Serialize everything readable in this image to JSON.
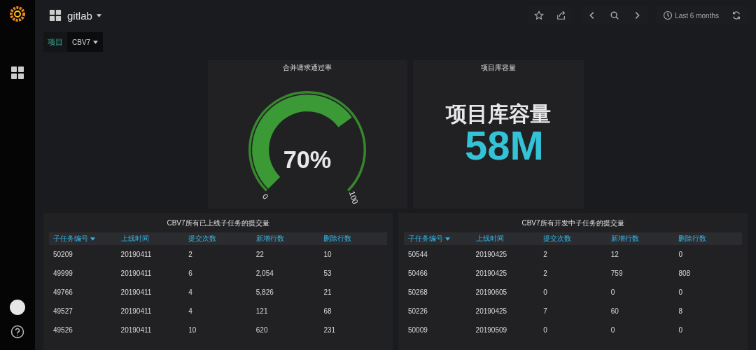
{
  "dashboard": {
    "title": "gitlab"
  },
  "toolbar": {
    "time_range": "Last 6 months"
  },
  "variable": {
    "label": "项目",
    "value": "CBV7"
  },
  "gauge": {
    "title": "合并请求通过率",
    "value": "70%",
    "min": "0",
    "max": "100"
  },
  "stat": {
    "title": "项目库容量",
    "prefix": "项目库容量",
    "value": "58M"
  },
  "tables": [
    {
      "title": "CBV7所有已上线子任务的提交量",
      "columns": [
        {
          "label": "子任务编号",
          "sorted": true
        },
        {
          "label": "上线时间",
          "sorted": false
        },
        {
          "label": "提交次数",
          "sorted": false
        },
        {
          "label": "新增行数",
          "sorted": false
        },
        {
          "label": "删除行数",
          "sorted": false
        }
      ],
      "rows": [
        [
          "50209",
          "20190411",
          "2",
          "22",
          "10"
        ],
        [
          "49999",
          "20190411",
          "6",
          "2,054",
          "53"
        ],
        [
          "49766",
          "20190411",
          "4",
          "5,826",
          "21"
        ],
        [
          "49527",
          "20190411",
          "4",
          "121",
          "68"
        ],
        [
          "49526",
          "20190411",
          "10",
          "620",
          "231"
        ]
      ]
    },
    {
      "title": "CBV7所有开发中子任务的提交量",
      "columns": [
        {
          "label": "子任务编号",
          "sorted": true
        },
        {
          "label": "上线时间",
          "sorted": false
        },
        {
          "label": "提交次数",
          "sorted": false
        },
        {
          "label": "新增行数",
          "sorted": false
        },
        {
          "label": "删除行数",
          "sorted": false
        }
      ],
      "rows": [
        [
          "50544",
          "20190425",
          "2",
          "12",
          "0"
        ],
        [
          "50466",
          "20190425",
          "2",
          "759",
          "808"
        ],
        [
          "50268",
          "20190605",
          "0",
          "0",
          "0"
        ],
        [
          "50226",
          "20190425",
          "7",
          "60",
          "8"
        ],
        [
          "50009",
          "20190509",
          "0",
          "0",
          "0"
        ]
      ]
    }
  ]
}
